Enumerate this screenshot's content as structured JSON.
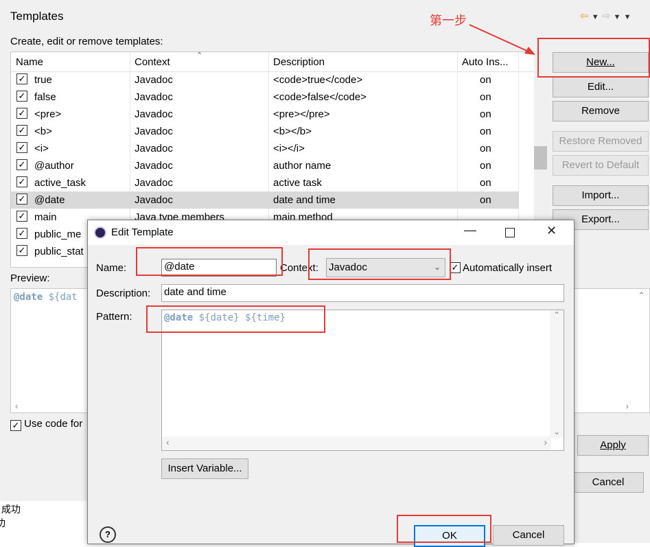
{
  "preferences": {
    "title": "Templates",
    "subtitle": "Create, edit or remove templates:",
    "columns": [
      "Name",
      "Context",
      "Description",
      "Auto Ins..."
    ],
    "rows": [
      {
        "name": "true",
        "context": "Javadoc",
        "description": "<code>true</code>",
        "auto": "on"
      },
      {
        "name": "false",
        "context": "Javadoc",
        "description": "<code>false</code>",
        "auto": "on"
      },
      {
        "name": "<pre>",
        "context": "Javadoc",
        "description": "<pre></pre>",
        "auto": "on"
      },
      {
        "name": "<b>",
        "context": "Javadoc",
        "description": "<b></b>",
        "auto": "on"
      },
      {
        "name": "<i>",
        "context": "Javadoc",
        "description": "<i></i>",
        "auto": "on"
      },
      {
        "name": "@author",
        "context": "Javadoc",
        "description": "author name",
        "auto": "on"
      },
      {
        "name": "active_task",
        "context": "Javadoc",
        "description": "active task",
        "auto": "on"
      },
      {
        "name": "@date",
        "context": "Javadoc",
        "description": "date and time",
        "auto": "on"
      },
      {
        "name": "main",
        "context": "Java type members",
        "description": "main method",
        "auto": ""
      },
      {
        "name": "public_me",
        "context": "",
        "description": "",
        "auto": ""
      },
      {
        "name": "public_stat",
        "context": "",
        "description": "",
        "auto": ""
      }
    ],
    "buttons": {
      "new": "New...",
      "edit": "Edit...",
      "remove": "Remove",
      "restore_removed": "Restore Removed",
      "revert": "Revert to Default",
      "import": "Import...",
      "export": "Export...",
      "apply": "Apply",
      "cancel": "Cancel"
    },
    "preview_label": "Preview:",
    "preview_text_kw": "@date",
    "preview_text_rest": " ${dat",
    "use_code_formatter": "Use code for"
  },
  "annotation": {
    "step_label": "第一步"
  },
  "background_text": [
    "成功",
    "功"
  ],
  "dialog": {
    "title": "Edit Template",
    "name_label": "Name:",
    "name_value": "@date",
    "context_label": "Context:",
    "context_value": "Javadoc",
    "auto_insert_label": "Automatically insert",
    "description_label": "Description:",
    "description_value": "date and time",
    "pattern_label": "Pattern:",
    "pattern_kw": "@date",
    "pattern_rest": " ${date} ${time}",
    "insert_variable": "Insert Variable...",
    "ok": "OK",
    "cancel": "Cancel",
    "help": "?"
  },
  "colors": {
    "annotation_red": "#e53935",
    "javadoc_keyword": "#7f9fbf",
    "selected_row": "#d9d9d9"
  }
}
